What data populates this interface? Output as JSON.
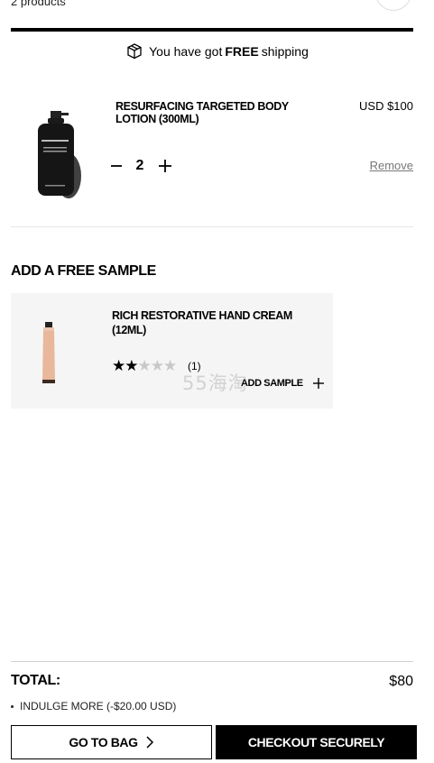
{
  "header": {
    "product_count": "2 products"
  },
  "shipping": {
    "prefix": "You have got",
    "highlight": "FREE",
    "suffix": "shipping",
    "progress": 1.0
  },
  "cart_item": {
    "title": "RESURFACING TARGETED BODY LOTION (300ML)",
    "price": "USD $100",
    "quantity": "2",
    "remove_label": "Remove"
  },
  "samples": {
    "heading": "ADD A FREE SAMPLE",
    "item": {
      "title": "RICH RESTORATIVE HAND CREAM (12ML)",
      "rating": 2,
      "rating_max": 5,
      "review_count": "(1)",
      "add_label": "ADD SAMPLE"
    }
  },
  "watermark": "55海淘",
  "summary": {
    "total_label": "TOTAL:",
    "total_value": "$80",
    "discount": "INDULGE MORE (-$20.00 USD)"
  },
  "actions": {
    "go_to_bag": "GO TO BAG",
    "checkout": "CHECKOUT SECURELY"
  },
  "icons": {
    "shipping": "box-icon",
    "minus": "minus-icon",
    "plus": "plus-icon",
    "chevron": "chevron-right-icon"
  },
  "colors": {
    "accent": "#000000",
    "card_bg": "#f5f5f5",
    "muted": "#777777"
  }
}
